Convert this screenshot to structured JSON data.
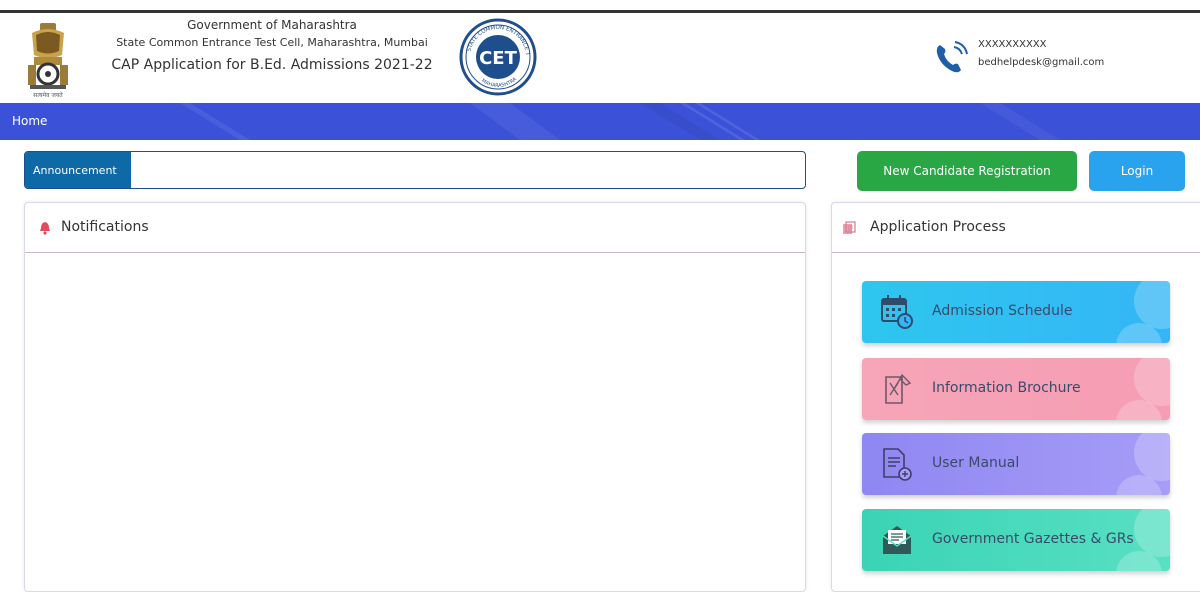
{
  "header": {
    "line1": "Government of Maharashtra",
    "line2": "State Common Entrance Test Cell, Maharashtra, Mumbai",
    "line3": "CAP Application for B.Ed. Admissions 2021-22",
    "emblem_caption": "सत्यमेव जयते",
    "logo_text": "CET",
    "logo_ring_top": "STATE COMMON ENTRANCE TEST CELL",
    "logo_ring_bottom": "MAHARASHTRA"
  },
  "contact": {
    "phone": "XXXXXXXXXX",
    "email": "bedhelpdesk@gmail.com"
  },
  "nav": {
    "home": "Home"
  },
  "announcement": {
    "label": "Announcement"
  },
  "buttons": {
    "register": "New Candidate Registration",
    "login": "Login"
  },
  "notifications": {
    "title": "Notifications"
  },
  "process": {
    "title": "Application Process",
    "items": [
      {
        "label": "Admission Schedule",
        "icon": "calendar-clock-icon"
      },
      {
        "label": "Information Brochure",
        "icon": "brochure-icon"
      },
      {
        "label": "User Manual",
        "icon": "document-add-icon"
      },
      {
        "label": "Government Gazettes & GRs",
        "icon": "envelope-letter-icon"
      }
    ]
  },
  "colors": {
    "nav_bg": "#3b52d8",
    "register_btn": "#29a745",
    "login_btn": "#2aa3ef",
    "announcement_label_bg": "#0d6aa6"
  }
}
